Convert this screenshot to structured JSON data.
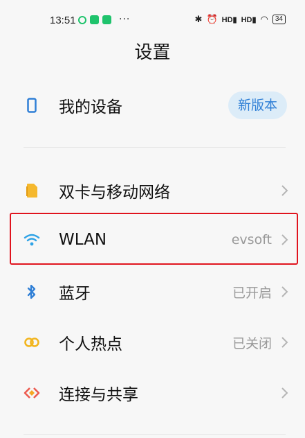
{
  "status_bar": {
    "time": "13:51",
    "more": "···",
    "signal_1": "HD",
    "signal_2": "HD",
    "battery": "34"
  },
  "page": {
    "title": "设置"
  },
  "device": {
    "label": "我的设备",
    "badge": "新版本"
  },
  "items": [
    {
      "label": "双卡与移动网络",
      "value": "",
      "icon": "sim-card-icon"
    },
    {
      "label": "WLAN",
      "value": "evsoft",
      "icon": "wifi-icon"
    },
    {
      "label": "蓝牙",
      "value": "已开启",
      "icon": "bluetooth-icon"
    },
    {
      "label": "个人热点",
      "value": "已关闭",
      "icon": "hotspot-icon"
    },
    {
      "label": "连接与共享",
      "value": "",
      "icon": "connection-share-icon"
    }
  ],
  "colors": {
    "accent": "#2f7fd6",
    "highlight": "#e0141e",
    "sim": "#f5b82e",
    "wifi": "#2fa3e6",
    "hotspot": "#f2b51e",
    "share": "#ec5a4f"
  }
}
